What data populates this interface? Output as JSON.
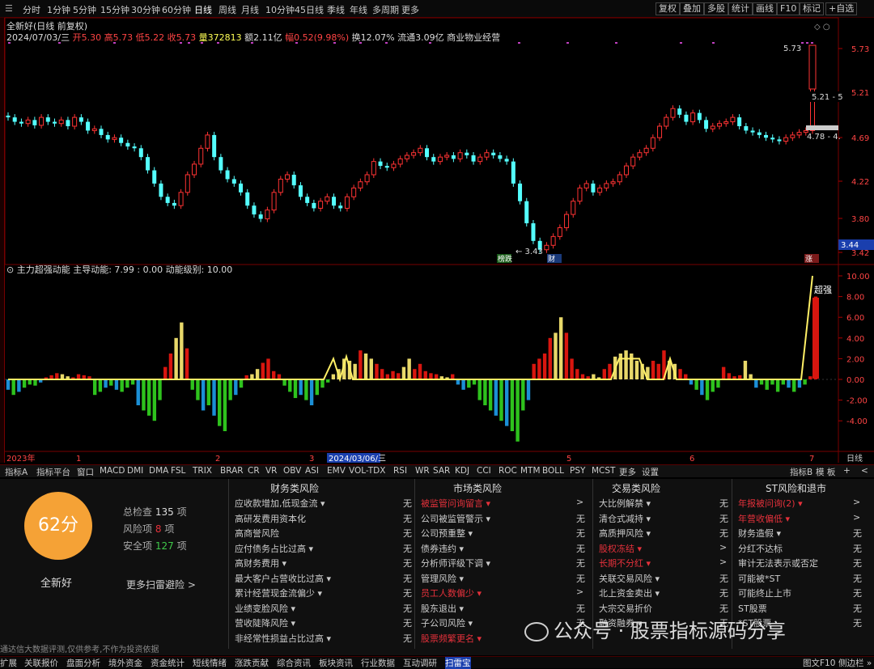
{
  "topbar": {
    "periods": [
      "分时",
      "1分钟",
      "5分钟",
      "15分钟",
      "30分钟",
      "60分钟",
      "日线",
      "周线",
      "月线",
      "10分钟",
      "45日线",
      "季线",
      "年线",
      "多周期",
      "更多"
    ],
    "right": [
      "复权",
      "叠加",
      "多股",
      "统计",
      "画线",
      "F10",
      "标记",
      "+自选"
    ]
  },
  "info": {
    "stock": "全新好(日线 前复权)",
    "date": "2024/07/03/三",
    "open": "开5.30",
    "high": "高5.73",
    "low": "低5.22",
    "close": "收5.73",
    "vol": "量372813",
    "amt": "额2.11亿",
    "chg": "幅0.52(9.98%)",
    "turnover": "换12.07%",
    "float": "流通3.09亿",
    "industry": "商业物业经营"
  },
  "price_axis": [
    "5.73",
    "5.21",
    "4.69",
    "4.22",
    "3.80",
    "3.42"
  ],
  "price_tags": {
    "high": "5.73",
    "mid": "5.21 - 5",
    "low": "4.78 - 4.",
    "last": "3.44",
    "min": "3.43"
  },
  "markers": {
    "m1": "榜跌",
    "m2": "财",
    "m3": "涨"
  },
  "indicator": {
    "title": "主力超强动能",
    "main": "主导动能: 7.99 : 0.00",
    "level": "动能级别: 10.00",
    "label": "超强",
    "axis": [
      "10.00",
      "8.00",
      "6.00",
      "4.00",
      "2.00",
      "0.00",
      "-2.00",
      "-4.00"
    ]
  },
  "timeaxis": {
    "year": "2023年",
    "months": [
      "1",
      "2",
      "3",
      "5",
      "6",
      "7"
    ],
    "date": "2024/03/06/三",
    "period": "日线"
  },
  "indtabs": [
    "指标A",
    "指标平台",
    "窗口",
    "MACD",
    "DMI",
    "DMA",
    "FSL",
    "TRIX",
    "BRAR",
    "CR",
    "VR",
    "OBV",
    "ASI",
    "EMV",
    "VOL-TDX",
    "RSI",
    "WR",
    "SAR",
    "KDJ",
    "CCI",
    "ROC",
    "MTM",
    "BOLL",
    "PSY",
    "MCST",
    "更多",
    "设置"
  ],
  "indright": [
    "指标B",
    "模 板",
    "+",
    "<"
  ],
  "risk": {
    "score": "62分",
    "name": "全新好",
    "check_label": "总检查",
    "check_num": "135",
    "check_unit": "项",
    "risk_label": "风险项",
    "risk_num": "8",
    "risk_unit": "项",
    "safe_label": "安全项",
    "safe_num": "127",
    "safe_unit": "项",
    "more": "更多扫雷避险 >",
    "disclaimer": "通达信大数据评测,仅供参考,不作为投资依据",
    "cols": [
      {
        "title": "财务类风险",
        "items": [
          [
            "应收款增加,低现金流 ▾",
            "无",
            0
          ],
          [
            "高研发费用资本化",
            "无",
            0
          ],
          [
            "高商誉风险",
            "无",
            0
          ],
          [
            "应付债务占比过高 ▾",
            "无",
            0
          ],
          [
            "高财务费用 ▾",
            "无",
            0
          ],
          [
            "最大客户占营收比过高 ▾",
            "无",
            0
          ],
          [
            "累计经营现金流偏少 ▾",
            "无",
            0
          ],
          [
            "业绩变脸风险 ▾",
            "无",
            0
          ],
          [
            "营收陡降风险 ▾",
            "无",
            0
          ],
          [
            "非经常性损益占比过高 ▾",
            "无",
            0
          ]
        ]
      },
      {
        "title": "市场类风险",
        "items": [
          [
            "被监管问询留言 ▾",
            ">",
            1
          ],
          [
            "公司被监管警示 ▾",
            "无",
            0
          ],
          [
            "公司预重整 ▾",
            "无",
            0
          ],
          [
            "债券违约 ▾",
            "无",
            0
          ],
          [
            "分析师评级下调 ▾",
            "无",
            0
          ],
          [
            "管理风险 ▾",
            "无",
            0
          ],
          [
            "员工人数偏少 ▾",
            ">",
            1
          ],
          [
            "股东退出 ▾",
            "无",
            0
          ],
          [
            "子公司风险 ▾",
            "无",
            0
          ],
          [
            "股票频繁更名 ▾",
            "",
            1
          ]
        ]
      },
      {
        "title": "交易类风险",
        "items": [
          [
            "大比例解禁 ▾",
            "无",
            0
          ],
          [
            "清仓式减持 ▾",
            "无",
            0
          ],
          [
            "高质押风险 ▾",
            "无",
            0
          ],
          [
            "股权冻结 ▾",
            ">",
            1
          ],
          [
            "长期不分红 ▾",
            ">",
            1
          ],
          [
            "关联交易风险 ▾",
            "无",
            0
          ],
          [
            "北上资金卖出 ▾",
            "无",
            0
          ],
          [
            "大宗交易折价",
            "无",
            0
          ],
          [
            "融资融券 ▾",
            "无",
            0
          ],
          [
            "",
            "",
            0
          ]
        ]
      },
      {
        "title": "ST风险和退市",
        "items": [
          [
            "年报被问询(2) ▾",
            ">",
            1
          ],
          [
            "年营收偏低 ▾",
            ">",
            1
          ],
          [
            "财务造假 ▾",
            "无",
            0
          ],
          [
            "分红不达标",
            "无",
            0
          ],
          [
            "审计无法表示或否定",
            "无",
            0
          ],
          [
            "可能被*ST",
            "无",
            0
          ],
          [
            "可能终止上市",
            "无",
            0
          ],
          [
            "ST股票",
            "无",
            0
          ],
          [
            "*ST股票",
            "无",
            0
          ],
          [
            "",
            "",
            0
          ]
        ]
      }
    ]
  },
  "bottomtabs": [
    "扩展",
    "关联报价",
    "盘面分析",
    "境外资金",
    "资金统计",
    "短线情绪",
    "涨跌贡献",
    "综合资讯",
    "板块资讯",
    "行业数据",
    "互动调研",
    "扫雷宝"
  ],
  "bottomright": [
    "图文F10",
    "侧边栏 »"
  ],
  "watermark": "公众号 · 股票指标源码分享",
  "colors": {
    "up": "#ff3333",
    "down": "#54ffff",
    "bar_red": "#d8160f",
    "bar_yellow": "#e8d86a",
    "bar_green": "#2ec21d",
    "bar_blue": "#1b8fd6",
    "score": "#f5a236"
  }
}
